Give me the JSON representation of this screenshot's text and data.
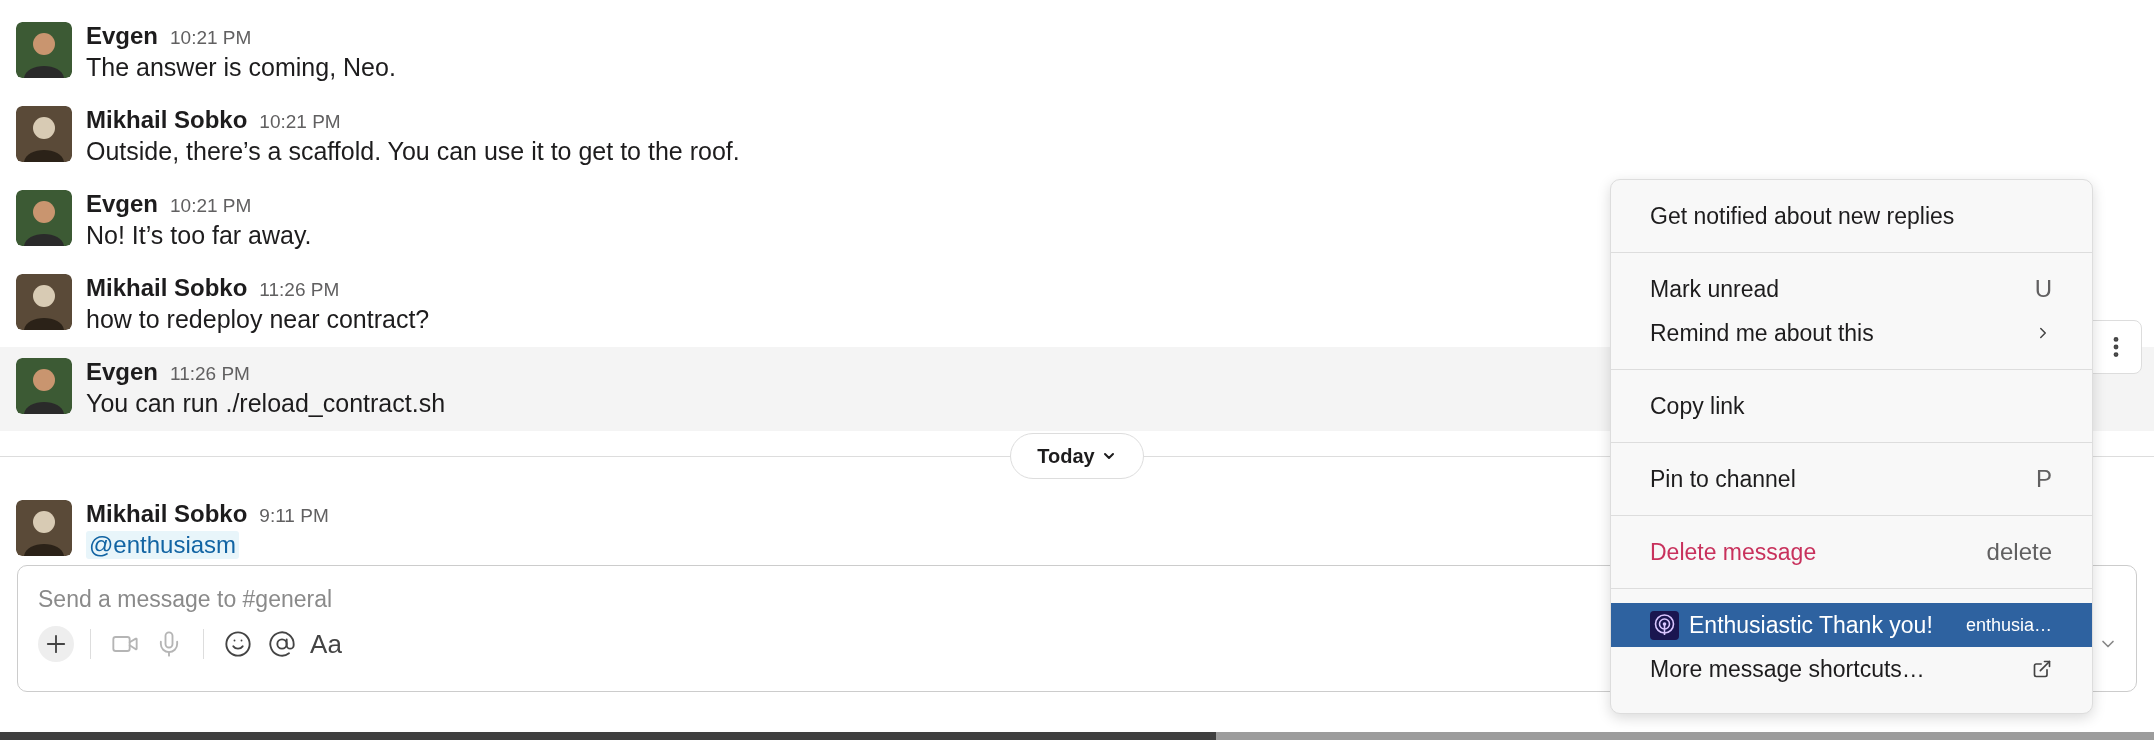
{
  "messages": [
    {
      "author": "Evgen",
      "kind": "glasses",
      "time": "10:21 PM",
      "text": "The answer is coming, Neo.",
      "highlighted": false
    },
    {
      "author": "Mikhail Sobko",
      "kind": "sepia",
      "time": "10:21 PM",
      "text": "Outside, there’s a scaffold. You can use it to get to the roof.",
      "highlighted": false
    },
    {
      "author": "Evgen",
      "kind": "glasses",
      "time": "10:21 PM",
      "text": "No! It’s too far away.",
      "highlighted": false
    },
    {
      "author": "Mikhail Sobko",
      "kind": "sepia",
      "time": "11:26 PM",
      "text": "how to redeploy near contract?",
      "highlighted": false
    },
    {
      "author": "Evgen",
      "kind": "glasses",
      "time": "11:26 PM",
      "text": "You can run ./reload_contract.sh",
      "highlighted": true
    }
  ],
  "date_divider": {
    "label": "Today"
  },
  "later_messages": [
    {
      "author": "Mikhail Sobko",
      "kind": "sepia",
      "time": "9:11 PM",
      "mention": "@enthusiasm"
    }
  ],
  "composer": {
    "placeholder": "Send a message to #general",
    "tool_groups": [
      [
        {
          "kind": "attach",
          "disabled": false
        }
      ],
      [
        {
          "kind": "video",
          "disabled": true
        },
        {
          "kind": "mic",
          "disabled": true
        }
      ],
      [
        {
          "kind": "emoji",
          "disabled": false
        },
        {
          "kind": "mention",
          "disabled": false
        },
        {
          "kind": "format",
          "label": "Aa",
          "disabled": false
        }
      ]
    ]
  },
  "context_menu": {
    "sections": [
      [
        {
          "kind": "plain",
          "label": "Get notified about new replies",
          "selected": false
        }
      ],
      [
        {
          "kind": "plain",
          "label": "Mark unread",
          "shortcut": "U",
          "selected": false
        },
        {
          "kind": "submenu",
          "label": "Remind me about this",
          "selected": false
        }
      ],
      [
        {
          "kind": "plain",
          "label": "Copy link",
          "selected": false
        }
      ],
      [
        {
          "kind": "plain",
          "label": "Pin to channel",
          "shortcut": "P",
          "selected": false
        }
      ],
      [
        {
          "kind": "danger",
          "label": "Delete message",
          "shortcut": "delete",
          "selected": false
        }
      ],
      [
        {
          "kind": "app",
          "label": "Enthusiastic Thank you!",
          "detail": "enthusia…",
          "selected": true
        },
        {
          "kind": "external",
          "label": "More message shortcuts…",
          "selected": false
        }
      ]
    ]
  }
}
